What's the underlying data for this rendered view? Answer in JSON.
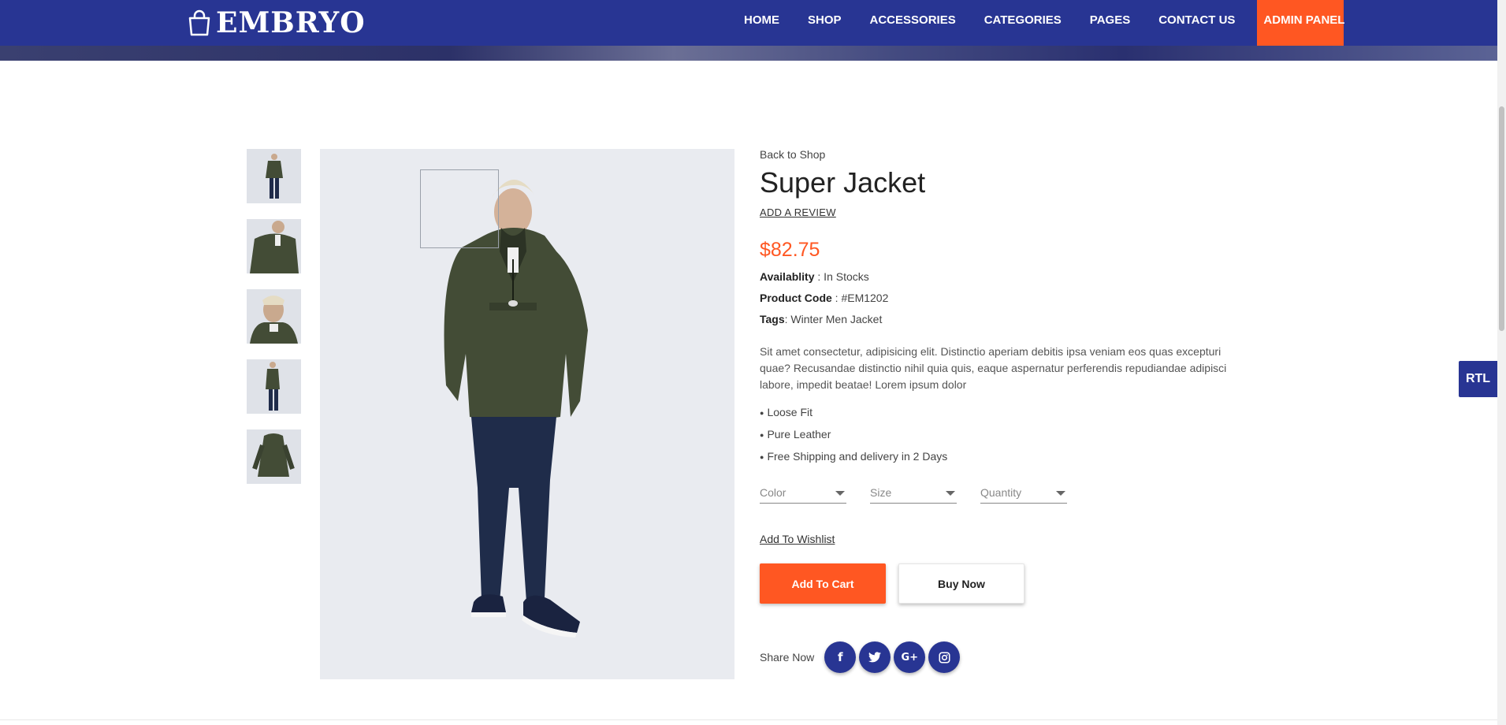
{
  "header": {
    "logo_text": "EMBRYO",
    "nav": [
      "HOME",
      "SHOP",
      "ACCESSORIES",
      "CATEGORIES",
      "PAGES",
      "CONTACT US"
    ],
    "admin_label": "ADMIN PANEL"
  },
  "product": {
    "back_label": "Back to Shop",
    "title": "Super Jacket",
    "review_label": "ADD A REVIEW",
    "price": "$82.75",
    "availability_key": "Availablity",
    "availability_value": " : In Stocks",
    "code_key": "Product Code",
    "code_value": " : #EM1202",
    "tags_key": "Tags",
    "tags_value": ": Winter Men Jacket",
    "description": "Sit amet consectetur, adipisicing elit. Distinctio aperiam debitis ipsa veniam eos quas excepturi quae? Recusandae distinctio nihil quia quis, eaque aspernatur perferendis repudiandae adipisci labore, impedit beatae! Lorem ipsum dolor",
    "features": [
      "Loose Fit",
      "Pure Leather",
      "Free Shipping and delivery in 2 Days"
    ],
    "selects": [
      "Color",
      "Size",
      "Quantity"
    ],
    "wishlist_label": "Add To Wishlist",
    "cart_label": "Add To Cart",
    "buy_label": "Buy Now",
    "share_label": "Share Now"
  },
  "social_icons": [
    "facebook-icon",
    "twitter-icon",
    "google-plus-icon",
    "instagram-icon"
  ],
  "rtl_label": "RTL",
  "colors": {
    "primary": "#283593",
    "accent": "#ff5722"
  }
}
